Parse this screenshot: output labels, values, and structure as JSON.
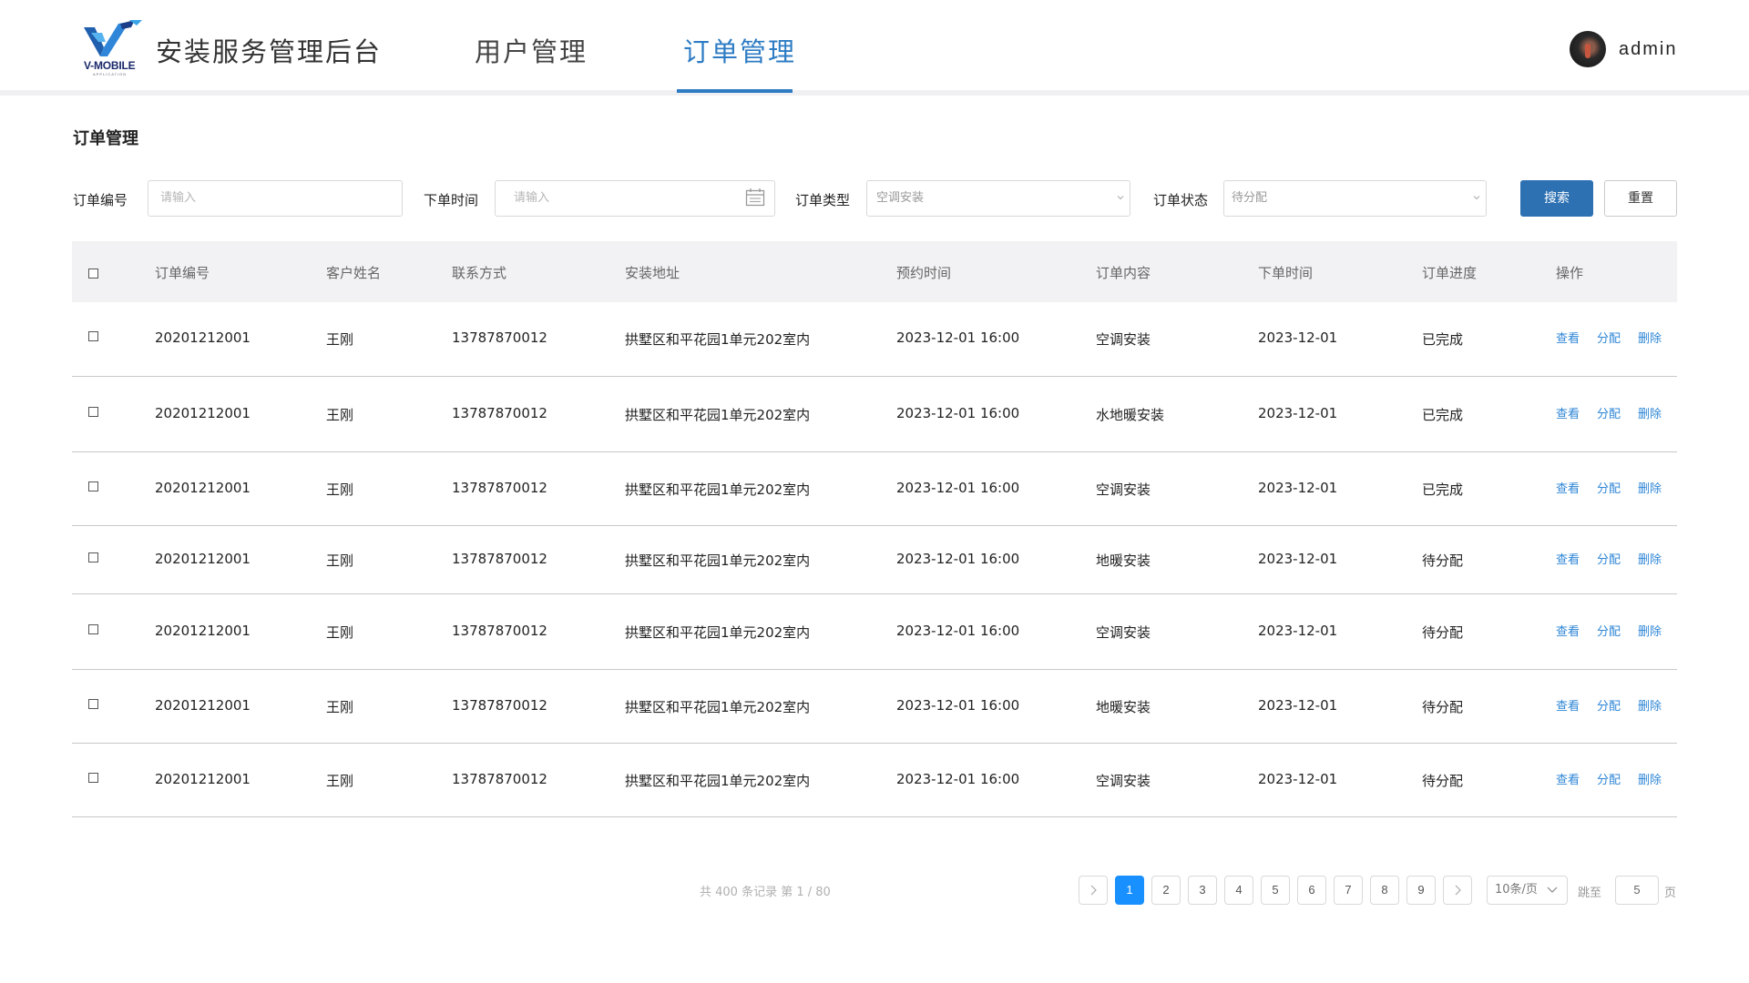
{
  "header": {
    "logo_text": "V-MOBILE",
    "logo_sub": "APPLICATION",
    "app_title": "安装服务管理后台",
    "nav": [
      {
        "label": "用户管理",
        "active": false
      },
      {
        "label": "订单管理",
        "active": true
      }
    ],
    "username": "admin",
    "accent_color": "#2e7cc4"
  },
  "page_title": "订单管理",
  "filters": {
    "order_no": {
      "label": "订单编号",
      "placeholder": "请输入"
    },
    "order_time": {
      "label": "下单时间",
      "placeholder": "请输入",
      "icon": "calendar-icon"
    },
    "order_type": {
      "label": "订单类型",
      "value": "空调安装"
    },
    "order_status": {
      "label": "订单状态",
      "value": "待分配"
    },
    "search_label": "搜索",
    "reset_label": "重置"
  },
  "table": {
    "columns": [
      "订单编号",
      "客户姓名",
      "联系方式",
      "安装地址",
      "预约时间",
      "订单内容",
      "下单时间",
      "订单进度",
      "操作"
    ],
    "actions": [
      "查看",
      "分配",
      "删除"
    ],
    "rows": [
      {
        "order_no": "20201212001",
        "name": "王刚",
        "phone": "13787870012",
        "address": "拱墅区和平花园1单元202室内",
        "appointment": "2023-12-01  16:00",
        "content": "空调安装",
        "order_date": "2023-12-01",
        "status": "已完成"
      },
      {
        "order_no": "20201212001",
        "name": "王刚",
        "phone": "13787870012",
        "address": "拱墅区和平花园1单元202室内",
        "appointment": "2023-12-01  16:00",
        "content": "水地暖安装",
        "order_date": "2023-12-01",
        "status": "已完成"
      },
      {
        "order_no": "20201212001",
        "name": "王刚",
        "phone": "13787870012",
        "address": "拱墅区和平花园1单元202室内",
        "appointment": "2023-12-01  16:00",
        "content": "空调安装",
        "order_date": "2023-12-01",
        "status": "已完成"
      },
      {
        "order_no": "20201212001",
        "name": "王刚",
        "phone": "13787870012",
        "address": "拱墅区和平花园1单元202室内",
        "appointment": "2023-12-01  16:00",
        "content": "地暖安装",
        "order_date": "2023-12-01",
        "status": "待分配"
      },
      {
        "order_no": "20201212001",
        "name": "王刚",
        "phone": "13787870012",
        "address": "拱墅区和平花园1单元202室内",
        "appointment": "2023-12-01  16:00",
        "content": "空调安装",
        "order_date": "2023-12-01",
        "status": "待分配"
      },
      {
        "order_no": "20201212001",
        "name": "王刚",
        "phone": "13787870012",
        "address": "拱墅区和平花园1单元202室内",
        "appointment": "2023-12-01  16:00",
        "content": "地暖安装",
        "order_date": "2023-12-01",
        "status": "待分配"
      },
      {
        "order_no": "20201212001",
        "name": "王刚",
        "phone": "13787870012",
        "address": "拱墅区和平花园1单元202室内",
        "appointment": "2023-12-01  16:00",
        "content": "空调安装",
        "order_date": "2023-12-01",
        "status": "待分配"
      }
    ]
  },
  "pagination": {
    "summary": "共 400 条记录 第 1 / 80",
    "pages": [
      "1",
      "2",
      "3",
      "4",
      "5",
      "6",
      "7",
      "8",
      "9"
    ],
    "current_page": "1",
    "page_size": "10条/页",
    "goto_label": "跳至",
    "goto_value": "5",
    "page_unit": "页"
  }
}
